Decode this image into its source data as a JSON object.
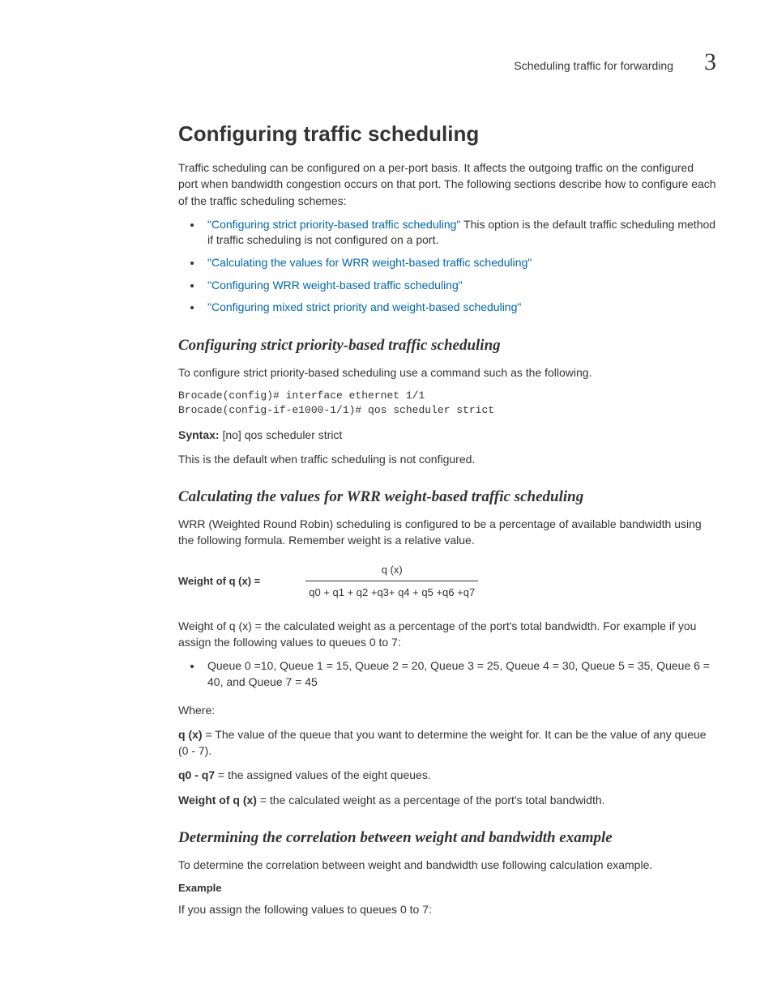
{
  "header": {
    "running_title": "Scheduling traffic for forwarding",
    "chapter_number": "3"
  },
  "section": {
    "title": "Configuring traffic scheduling",
    "intro": "Traffic scheduling can be configured on a per-port basis. It affects the outgoing traffic on the configured port when bandwidth congestion occurs on that port. The following sections describe how to configure each of the traffic scheduling schemes:",
    "bullets": [
      {
        "link": "\"Configuring strict priority-based traffic scheduling\"",
        "rest": " This option is the default traffic scheduling method if traffic scheduling is not configured on a port."
      },
      {
        "link": "\"Calculating the values for WRR weight-based traffic scheduling\"",
        "rest": ""
      },
      {
        "link": "\"Configuring WRR weight-based traffic scheduling\"",
        "rest": ""
      },
      {
        "link": "\"Configuring mixed strict priority and weight-based scheduling\"",
        "rest": ""
      }
    ]
  },
  "strict": {
    "title": "Configuring strict priority-based traffic scheduling",
    "intro": "To configure strict priority-based scheduling use a command such as the following.",
    "code": "Brocade(config)# interface ethernet 1/1\nBrocade(config-if-e1000-1/1)# qos scheduler strict",
    "syntax_label": "Syntax:",
    "syntax_body": "  [no] qos scheduler strict",
    "note": "This is the default when traffic scheduling is not configured."
  },
  "wrr": {
    "title": "Calculating the values for WRR weight-based traffic scheduling",
    "intro": "WRR (Weighted Round Robin) scheduling is configured to be a percentage of available bandwidth using the following formula. Remember weight is a relative value.",
    "formula": {
      "lhs": "Weight of q (x) =",
      "numerator": "q (x)",
      "denominator": "q0 + q1 + q2 +q3+ q4 + q5 +q6 +q7"
    },
    "after_formula": "Weight of q (x) = the calculated weight as a percentage of the port's total bandwidth. For example if you assign the following values to queues 0 to 7:",
    "queue_values": "Queue 0 =10, Queue 1 = 15, Queue 2 = 20, Queue 3 = 25, Queue 4 = 30, Queue 5 = 35, Queue 6 = 40, and Queue 7 = 45",
    "where_label": "Where:",
    "defs": {
      "qx_term": "q (x)",
      "qx_body": " = The value of the queue that you want to determine the weight for. It can be the value of any queue (0 - 7).",
      "range_term": "q0 - q7",
      "range_body": " = the assigned values of the eight queues.",
      "weight_term": "Weight of q (x)",
      "weight_body": " = the calculated weight as a percentage of the port's total bandwidth."
    }
  },
  "corr": {
    "title": "Determining the correlation between weight and bandwidth example",
    "intro": "To determine the correlation between weight and bandwidth use following calculation example.",
    "example_label": "Example",
    "example_intro": "If you assign the following values to queues 0 to 7:"
  }
}
